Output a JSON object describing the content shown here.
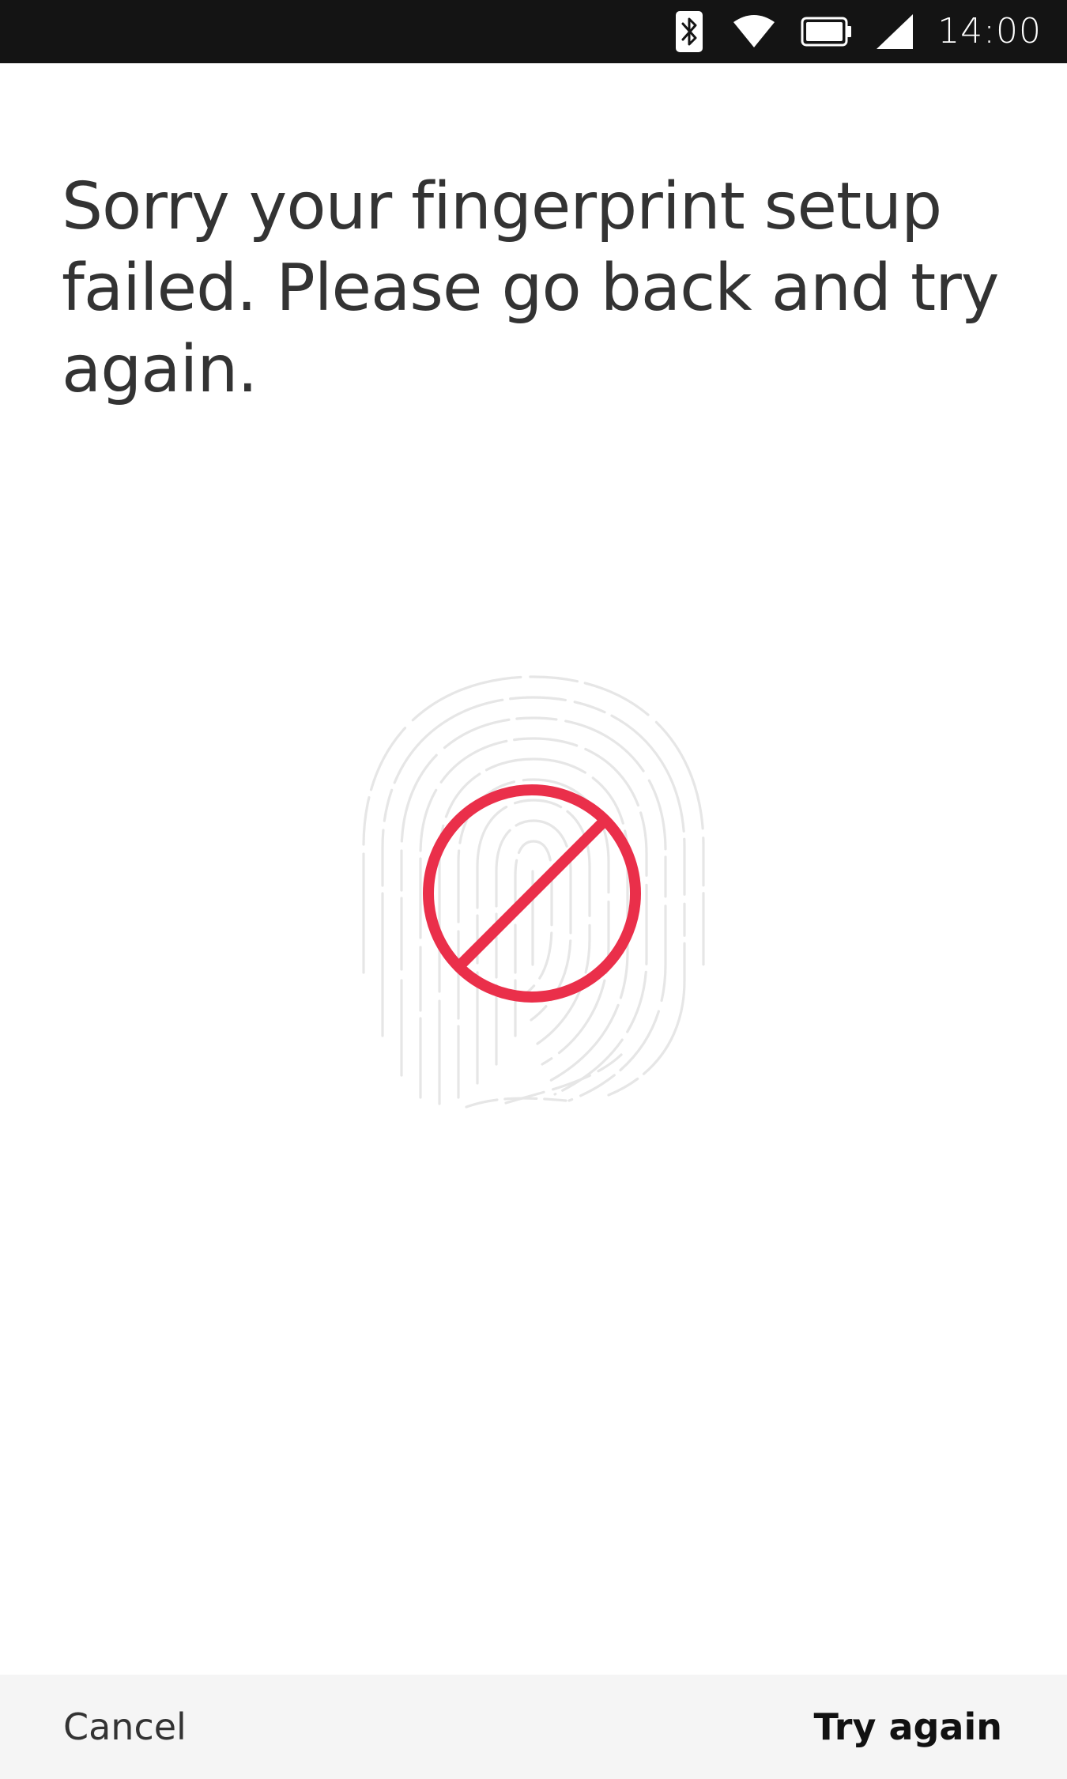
{
  "status_bar": {
    "time": "14:00",
    "icons": [
      "bluetooth-icon",
      "wifi-icon",
      "battery-icon",
      "cellular-signal-icon"
    ],
    "background": "#141414"
  },
  "main": {
    "message": "Sorry your fingerprint setup failed. Please go back and try again.",
    "illustration": {
      "icon": "fingerprint-icon",
      "overlay_icon": "prohibited-icon",
      "fingerprint_color": "#e6e6e6",
      "overlay_color": "#ea2f4a"
    }
  },
  "actions": {
    "cancel_label": "Cancel",
    "try_again_label": "Try again",
    "bar_background": "#f5f5f5"
  }
}
